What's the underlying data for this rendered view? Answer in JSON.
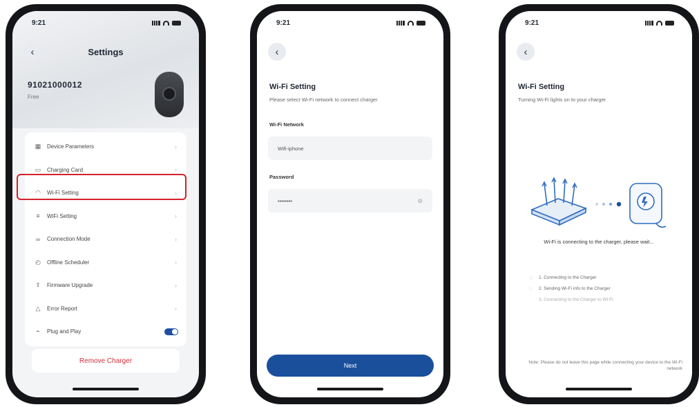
{
  "status_time": "9:21",
  "phone1": {
    "title": "Settings",
    "serial": "91021000012",
    "subtitle": "Free",
    "menu": [
      {
        "label": "Device Parameters",
        "icon": "grid-icon"
      },
      {
        "label": "Charging Card",
        "icon": "card-icon"
      },
      {
        "label": "Wi-Fi Setting",
        "icon": "wifi-icon"
      },
      {
        "label": "WiFi Setting",
        "icon": "list-icon"
      },
      {
        "label": "Connection Mode",
        "icon": "link-icon"
      },
      {
        "label": "Offline Scheduler",
        "icon": "clock-icon"
      },
      {
        "label": "Firmware Upgrade",
        "icon": "upload-icon"
      },
      {
        "label": "Error Report",
        "icon": "alert-icon"
      },
      {
        "label": "Plug and Play",
        "icon": "plug-icon",
        "toggle": true
      }
    ],
    "remove_label": "Remove Charger"
  },
  "phone2": {
    "title": "Wi-Fi Setting",
    "subtitle": "Please select Wi-Fi network to connect charger",
    "network_label": "Wi-Fi Network",
    "network_value": "Wifi-iphone",
    "password_label": "Password",
    "password_value": "••••••••",
    "next_label": "Next"
  },
  "phone3": {
    "title": "Wi-Fi Setting",
    "subtitle": "Turning Wi-Fi lights on to your charger",
    "connecting_text": "Wi-Fi is connecting to the charger, please wait...",
    "steps": [
      "1. Connecting to the Charger",
      "2. Sending Wi-Fi info to the Charger",
      "3. Connecting to the Charger to Wi-Fi"
    ],
    "tip": "Note: Please do not leave this page while connecting your device to the Wi-Fi network"
  },
  "colors": {
    "highlight": "#d3202b",
    "primary": "#1a4f9c",
    "danger": "#d12f3a"
  }
}
